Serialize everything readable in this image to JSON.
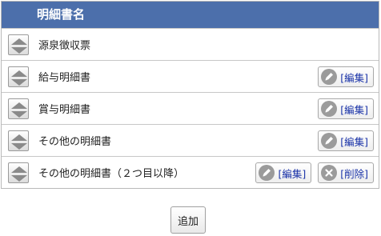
{
  "table": {
    "header_label": "明細書名",
    "rows": [
      {
        "name": "源泉徴収票",
        "actions": []
      },
      {
        "name": "給与明細書",
        "actions": [
          {
            "label": "[編集]",
            "icon": "pencil-icon"
          }
        ]
      },
      {
        "name": "賞与明細書",
        "actions": [
          {
            "label": "[編集]",
            "icon": "pencil-icon"
          }
        ]
      },
      {
        "name": "その他の明細書",
        "actions": [
          {
            "label": "[編集]",
            "icon": "pencil-icon"
          }
        ]
      },
      {
        "name": "その他の明細書（２つ目以降）",
        "actions": [
          {
            "label": "[編集]",
            "icon": "pencil-icon"
          },
          {
            "label": "[削除]",
            "icon": "close-icon"
          }
        ]
      }
    ]
  },
  "add_button_label": "追加",
  "colors": {
    "header_bg": "#4c6fab",
    "link_text": "#1a33a8",
    "icon_gray": "#9b9b9b"
  }
}
